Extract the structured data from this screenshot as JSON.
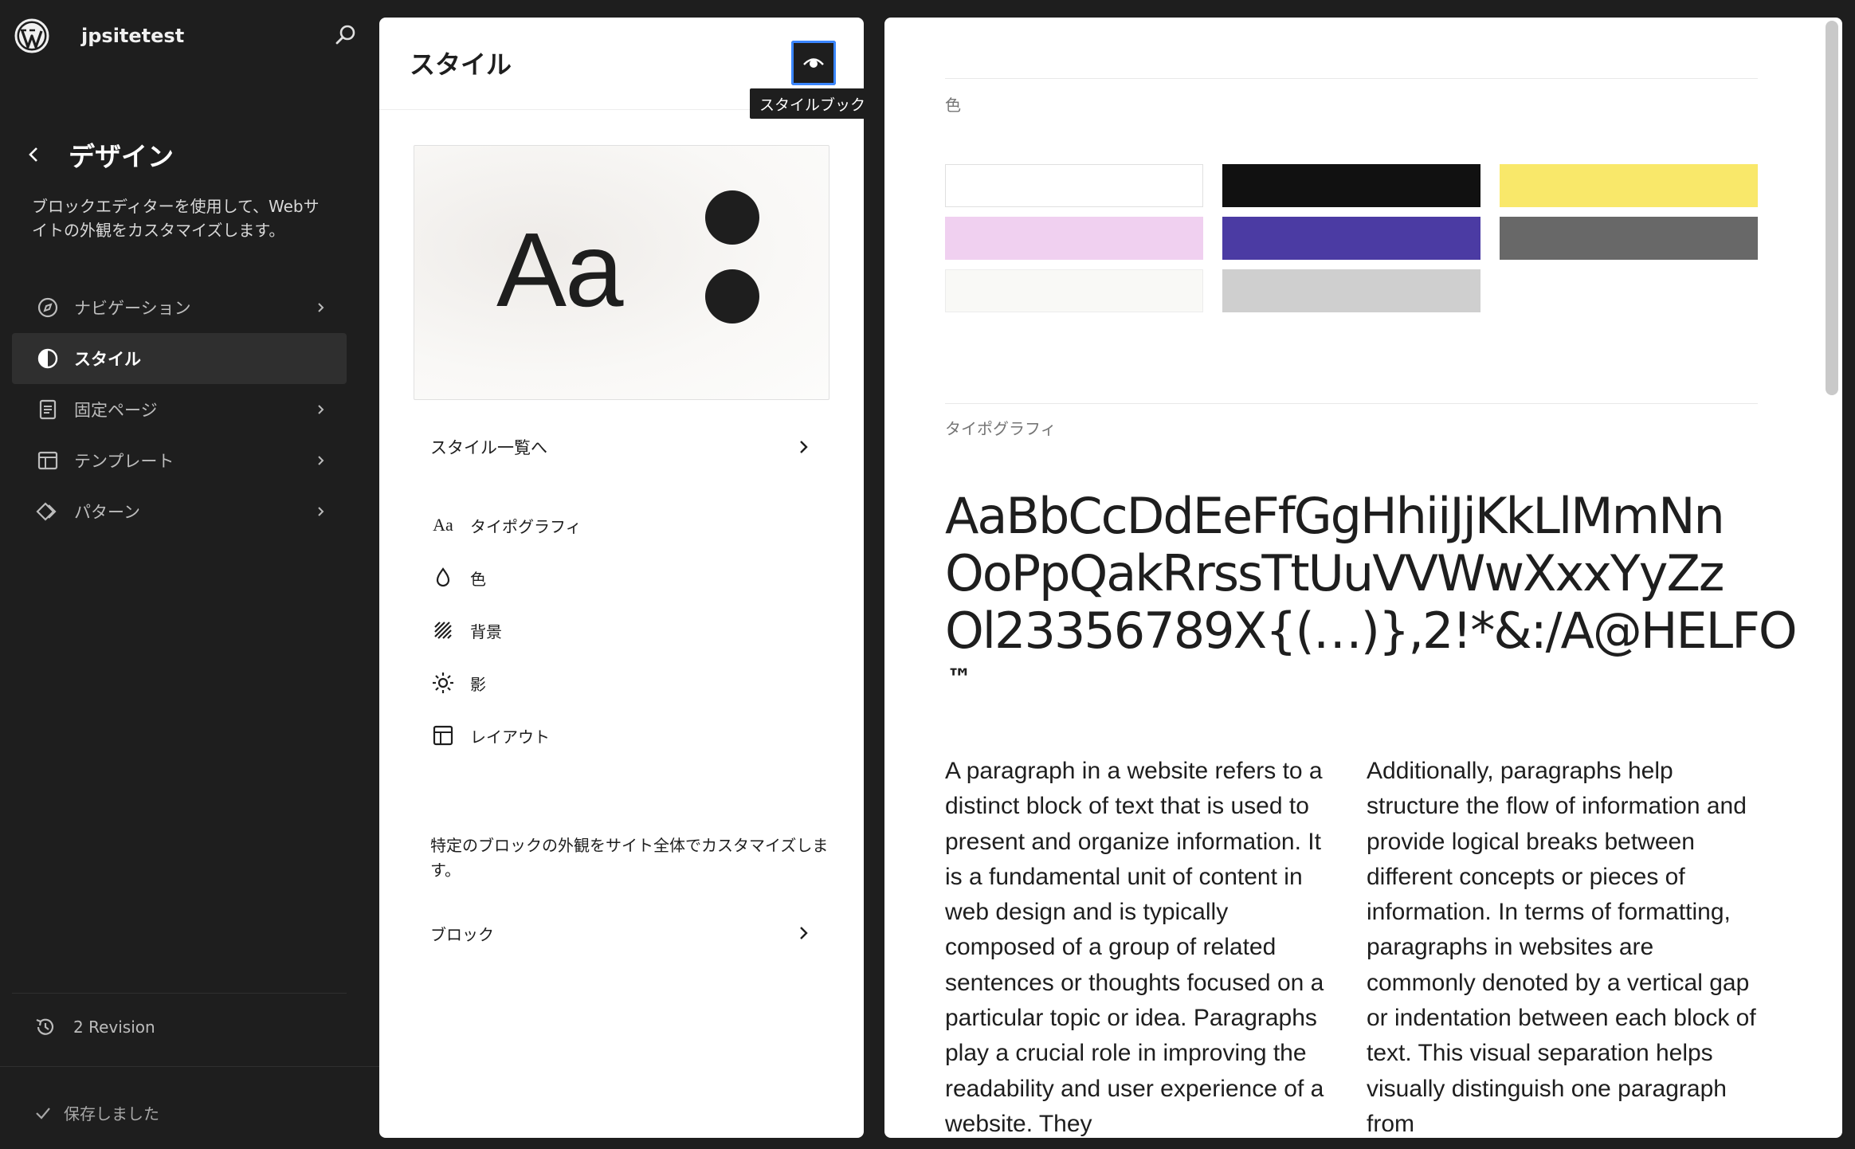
{
  "sidebar": {
    "site_name": "jpsitetest",
    "section_title": "デザイン",
    "description": "ブロックエディターを使用して、Webサイトの外観をカスタマイズします。",
    "nav_items": [
      {
        "label": "ナビゲーション",
        "icon": "compass-icon",
        "active": false,
        "chevron": true
      },
      {
        "label": "スタイル",
        "icon": "half-circle-icon",
        "active": true,
        "chevron": false
      },
      {
        "label": "固定ページ",
        "icon": "page-icon",
        "active": false,
        "chevron": true
      },
      {
        "label": "テンプレート",
        "icon": "layout-icon",
        "active": false,
        "chevron": true
      },
      {
        "label": "パターン",
        "icon": "symbol-icon",
        "active": false,
        "chevron": true
      }
    ],
    "revision_label": "2 Revision",
    "saved_label": "保存しました"
  },
  "panel": {
    "title": "スタイル",
    "stylebook_tooltip": "スタイルブック",
    "preview_text": "Aa",
    "style_list_label": "スタイル一覧へ",
    "menu": [
      {
        "label": "タイポグラフィ",
        "icon": "typography-icon",
        "glyph": "Aa"
      },
      {
        "label": "色",
        "icon": "droplet-icon"
      },
      {
        "label": "背景",
        "icon": "background-icon"
      },
      {
        "label": "影",
        "icon": "shadow-icon"
      },
      {
        "label": "レイアウト",
        "icon": "layout-icon"
      }
    ],
    "block_description": "特定のブロックの外観をサイト全体でカスタマイズします。",
    "block_label": "ブロック"
  },
  "stylebook": {
    "color_label": "色",
    "swatches": [
      "#ffffff",
      "#111111",
      "#f9e86a",
      "#f0d0f0",
      "#4b3ba3",
      "#686868",
      "#f9f9f6",
      "#cfcfcf"
    ],
    "typography_label": "タイポグラフィ",
    "typography_lines": [
      "AaBbCcDdEeFfGgHhiiJjKkLlMmNn",
      "OoPpQakRrssTtUuVVWwXxxYyZz",
      "Ol23356789X{(…)},2!*&:/A@HELFO"
    ],
    "typography_tm": "™",
    "paragraph_1": "A paragraph in a website refers to a distinct block of text that is used to present and organize information. It is a fundamental unit of content in web design and is typically composed of a group of related sentences or thoughts focused on a particular topic or idea. Paragraphs play a crucial role in improving the readability and user experience of a website. They",
    "paragraph_2": "Additionally, paragraphs help structure the flow of information and provide logical breaks between different concepts or pieces of information. In terms of formatting, paragraphs in websites are commonly denoted by a vertical gap or indentation between each block of text. This visual separation helps visually distinguish one paragraph from"
  }
}
